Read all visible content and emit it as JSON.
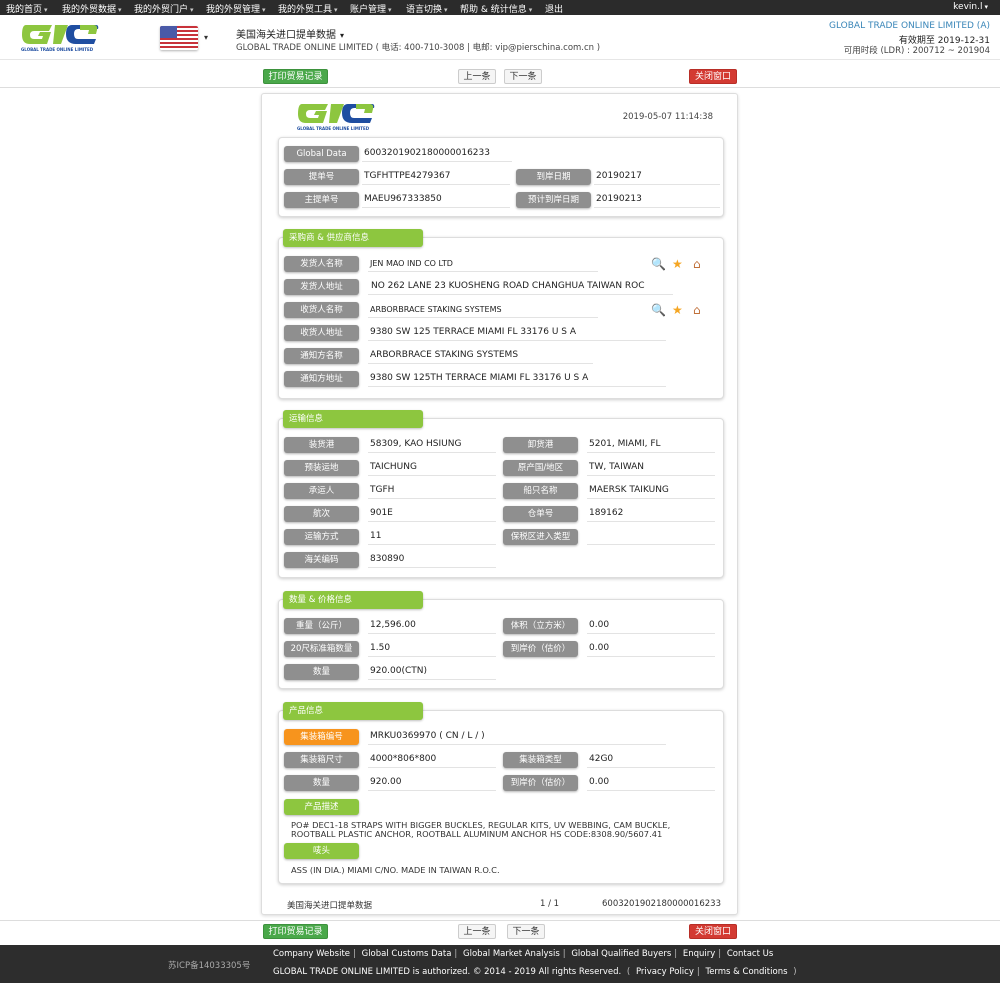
{
  "topnav": {
    "items": [
      "我的首页",
      "我的外贸数据",
      "我的外贸门户",
      "我的外贸管理",
      "我的外贸工具",
      "账户管理",
      "语言切换",
      "帮助 & 统计信息",
      "退出"
    ],
    "user": "kevin.l"
  },
  "header": {
    "logo_text": "GLOBAL TRADE ONLINE LIMITED",
    "country_icon": "us-flag-icon",
    "title": "美国海关进口提单数据",
    "subtitle": "GLOBAL TRADE ONLINE LIMITED ( 电话:  400-710-3008  |  电邮:  vip@pierschina.com.cn )",
    "company": "GLOBAL TRADE ONLINE LIMITED (A)",
    "valid_until": "有效期至 2019-12-31",
    "ldr": "可用时段 (LDR) : 200712 ~ 201904"
  },
  "toolbar": {
    "print_label": "打印贸易记录",
    "prev_label": "上一条",
    "next_label": "下一条",
    "close_label": "关闭窗口"
  },
  "record": {
    "timestamp": "2019-05-07 11:14:38",
    "ids": {
      "global_data_label": "Global Data",
      "global_data": "6003201902180000016233",
      "bill_no_label": "提单号",
      "bill_no": "TGFHTTPE4279367",
      "arrival_date_label": "到岸日期",
      "arrival_date": "20190217",
      "master_bill_label": "主提单号",
      "master_bill": "MAEU967333850",
      "est_arrival_label": "预计到岸日期",
      "est_arrival": "20190213"
    },
    "parties": {
      "title": "采购商 & 供应商信息",
      "rows": [
        {
          "label": "发货人名称",
          "value": "JEN MAO IND CO LTD",
          "icons": true
        },
        {
          "label": "发货人地址",
          "value": "NO 262 LANE 23 KUOSHENG ROAD CHANGHUA TAIWAN ROC",
          "icons": false
        },
        {
          "label": "收货人名称",
          "value": "ARBORBRACE STAKING SYSTEMS",
          "icons": true
        },
        {
          "label": "收货人地址",
          "value": "9380 SW 125 TERRACE MIAMI FL 33176 U S A",
          "icons": false
        },
        {
          "label": "通知方名称",
          "value": "ARBORBRACE STAKING SYSTEMS",
          "icons": false
        },
        {
          "label": "通知方地址",
          "value": "9380 SW 125TH TERRACE MIAMI FL 33176 U S A",
          "icons": false
        }
      ]
    },
    "transport": {
      "title": "运输信息",
      "rows": [
        {
          "l1": "装货港",
          "v1": "58309, KAO HSIUNG",
          "l2": "卸货港",
          "v2": "5201, MIAMI, FL"
        },
        {
          "l1": "预装运地",
          "v1": "TAICHUNG",
          "l2": "原产国/地区",
          "v2": "TW, TAIWAN"
        },
        {
          "l1": "承运人",
          "v1": "TGFH",
          "l2": "船只名称",
          "v2": "MAERSK TAIKUNG"
        },
        {
          "l1": "航次",
          "v1": "901E",
          "l2": "仓单号",
          "v2": "189162"
        },
        {
          "l1": "运输方式",
          "v1": "11",
          "l2": "保税区进入类型",
          "v2": ""
        },
        {
          "l1": "海关编码",
          "v1": "830890"
        }
      ]
    },
    "quantity": {
      "title": "数量 & 价格信息",
      "rows": [
        {
          "l1": "重量（公斤）",
          "v1": "12,596.00",
          "l2": "体积（立方米）",
          "v2": "0.00"
        },
        {
          "l1": "20尺标准箱数量",
          "v1": "1.50",
          "l2": "到岸价（估价）",
          "v2": "0.00"
        },
        {
          "l1": "数量",
          "v1": "920.00(CTN)"
        }
      ]
    },
    "product": {
      "title": "产品信息",
      "container_no_label": "集装箱编号",
      "container_no": "MRKU0369970 ( CN / L /  )",
      "container_size_label": "集装箱尺寸",
      "container_size": "4000*806*800",
      "container_type_label": "集装箱类型",
      "container_type": "42G0",
      "qty_label": "数量",
      "qty": "920.00",
      "cif_label": "到岸价（估价）",
      "cif": "0.00",
      "desc_label": "产品描述",
      "desc": "PO# DEC1-18 STRAPS WITH BIGGER BUCKLES, REGULAR KITS, UV WEBBING, CAM BUCKLE, ROOTBALL PLASTIC ANCHOR, ROOTBALL ALUMINUM ANCHOR HS CODE:8308.90/5607.41",
      "marks_label": "唛头",
      "marks": "ASS (IN DIA.) MIAMI C/NO. MADE IN TAIWAN R.O.C."
    },
    "footer": {
      "source": "美国海关进口提单数据",
      "pager": "1 / 1",
      "id": "6003201902180000016233"
    }
  },
  "footer": {
    "icp": "苏ICP备14033305号",
    "links": [
      "Company Website",
      "Global Customs Data",
      "Global Market Analysis",
      "Global Qualified Buyers",
      "Enquiry",
      "Contact Us"
    ],
    "copyright": "GLOBAL TRADE ONLINE LIMITED is authorized. © 2014 - 2019 All rights Reserved.",
    "privacy": "Privacy Policy",
    "terms": "Terms & Conditions"
  }
}
